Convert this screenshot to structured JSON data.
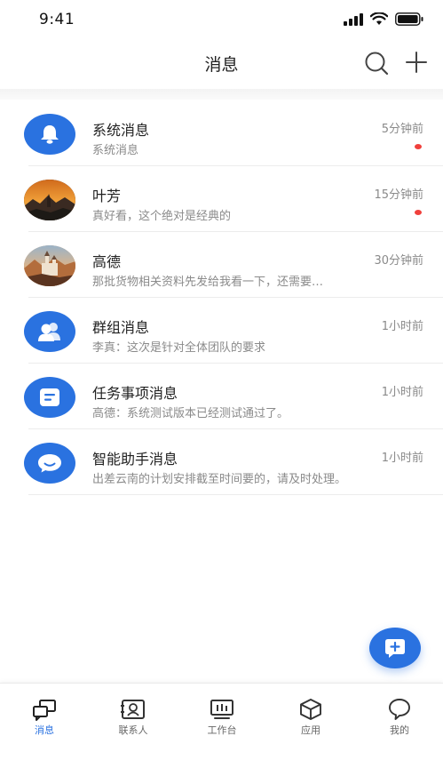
{
  "status_bar": {
    "time": "9:41",
    "icons": [
      "cellular-signal-icon",
      "wifi-icon",
      "battery-icon"
    ]
  },
  "nav": {
    "title": "消息",
    "icons": [
      "search-icon",
      "plus-icon"
    ]
  },
  "colors": {
    "accent": "#2a72e0",
    "unread": "#f0403c",
    "secondary_text": "#8a8a8a"
  },
  "messages": [
    {
      "title": "系统消息",
      "time": "5分钟前",
      "preview": "系统消息",
      "unread": true,
      "avatar": "bell-icon"
    },
    {
      "title": "叶芳",
      "time": "15分钟前",
      "preview": "真好看，这个绝对是经典的",
      "unread": true,
      "avatar": "landscape-photo"
    },
    {
      "title": "高德",
      "time": "30分钟前",
      "preview": "那批货物相关资料先发给我看一下，还需要…",
      "unread": false,
      "avatar": "castle-photo"
    },
    {
      "title": "群组消息",
      "time": "1小时前",
      "preview": "李真：这次是针对全体团队的要求",
      "unread": false,
      "avatar": "group-icon"
    },
    {
      "title": "任务事项消息",
      "time": "1小时前",
      "preview": "高德：系统测试版本已经测试通过了。",
      "unread": false,
      "avatar": "task-icon"
    },
    {
      "title": "智能助手消息",
      "time": "1小时前",
      "preview": "出差云南的计划安排截至时间要的，请及时处理。",
      "unread": false,
      "avatar": "chat-bubble-icon"
    }
  ],
  "fab": {
    "icon": "add-conversation-icon"
  },
  "tabs": [
    {
      "label": "消息",
      "icon": "messages-icon",
      "active": true
    },
    {
      "label": "联系人",
      "icon": "contacts-icon",
      "active": false
    },
    {
      "label": "工作台",
      "icon": "workbench-icon",
      "active": false
    },
    {
      "label": "应用",
      "icon": "apps-icon",
      "active": false
    },
    {
      "label": "我的",
      "icon": "profile-icon",
      "active": false
    }
  ]
}
